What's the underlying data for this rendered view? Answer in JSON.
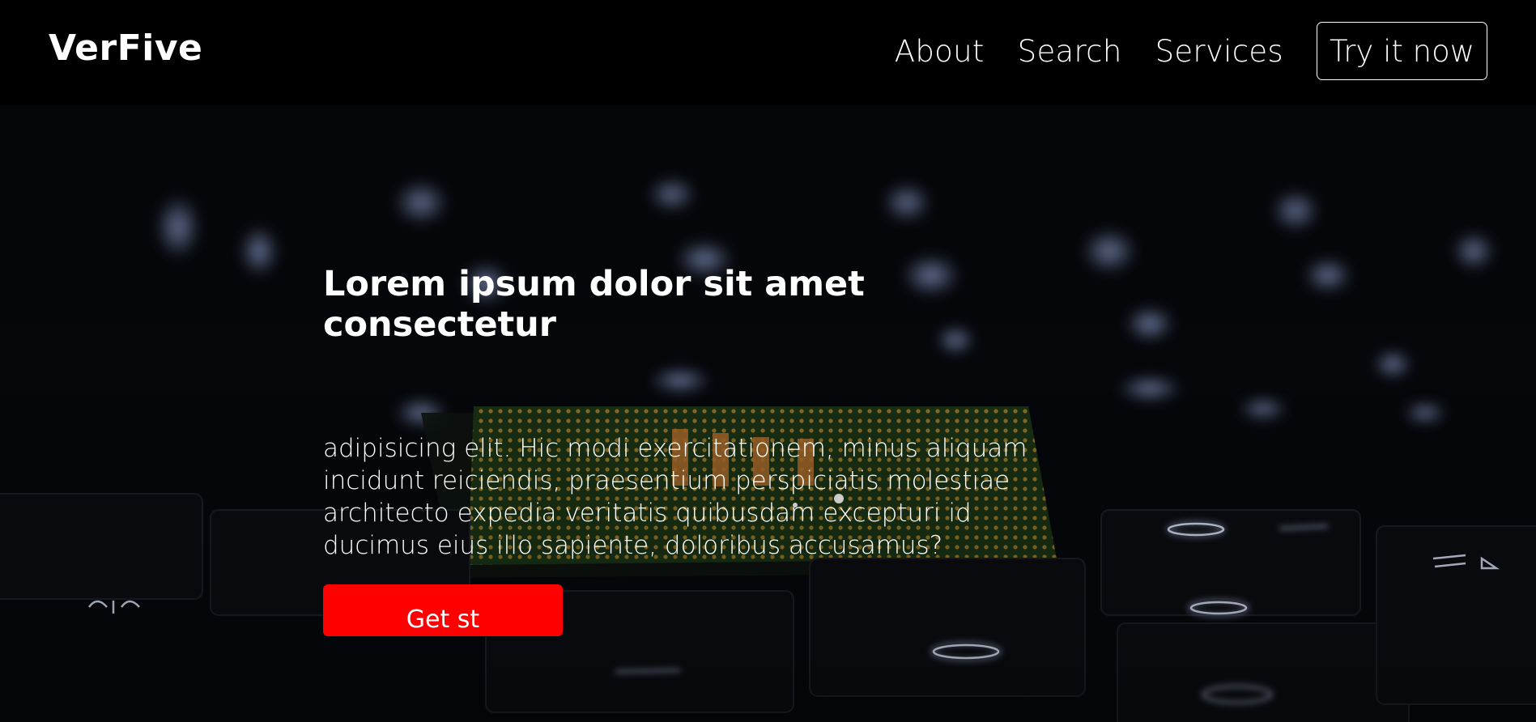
{
  "brand": {
    "name": "VerFive"
  },
  "nav": {
    "links": [
      "About",
      "Search",
      "Services"
    ],
    "cta_label": "Try it now"
  },
  "hero": {
    "title": "Lorem ipsum dolor sit amet consectetur",
    "body": "adipisicing elit. Hic modi exercitationem, minus aliquam incidunt reiciendis, praesentium perspiciatis molestiae architecto expedia veritatis quibusdam excepturi id ducimus eius illo sapiente, doloribus accusamus?",
    "button_label": "Get st"
  },
  "colors": {
    "navbar_background": "#000000",
    "text": "#ffffff",
    "accent_button": "#ff0000",
    "chip_green": "#2f5b24",
    "chip_gold": "#c7a13a"
  }
}
